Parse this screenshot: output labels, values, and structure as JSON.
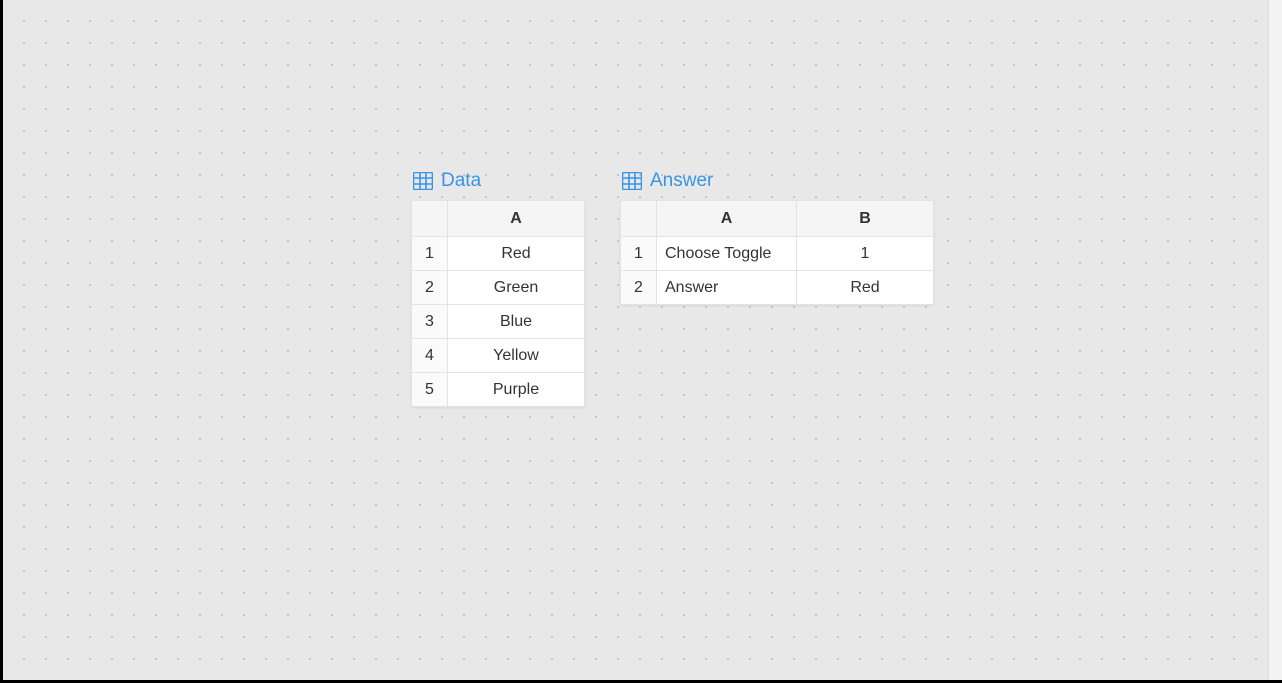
{
  "data_table": {
    "title": "Data",
    "headers": {
      "a": "A"
    },
    "rows": [
      {
        "n": "1",
        "a": "Red"
      },
      {
        "n": "2",
        "a": "Green"
      },
      {
        "n": "3",
        "a": "Blue"
      },
      {
        "n": "4",
        "a": "Yellow"
      },
      {
        "n": "5",
        "a": "Purple"
      }
    ]
  },
  "answer_table": {
    "title": "Answer",
    "headers": {
      "a": "A",
      "b": "B"
    },
    "rows": [
      {
        "n": "1",
        "a": "Choose Toggle",
        "b": "1"
      },
      {
        "n": "2",
        "a": "Answer",
        "b": "Red"
      }
    ]
  }
}
